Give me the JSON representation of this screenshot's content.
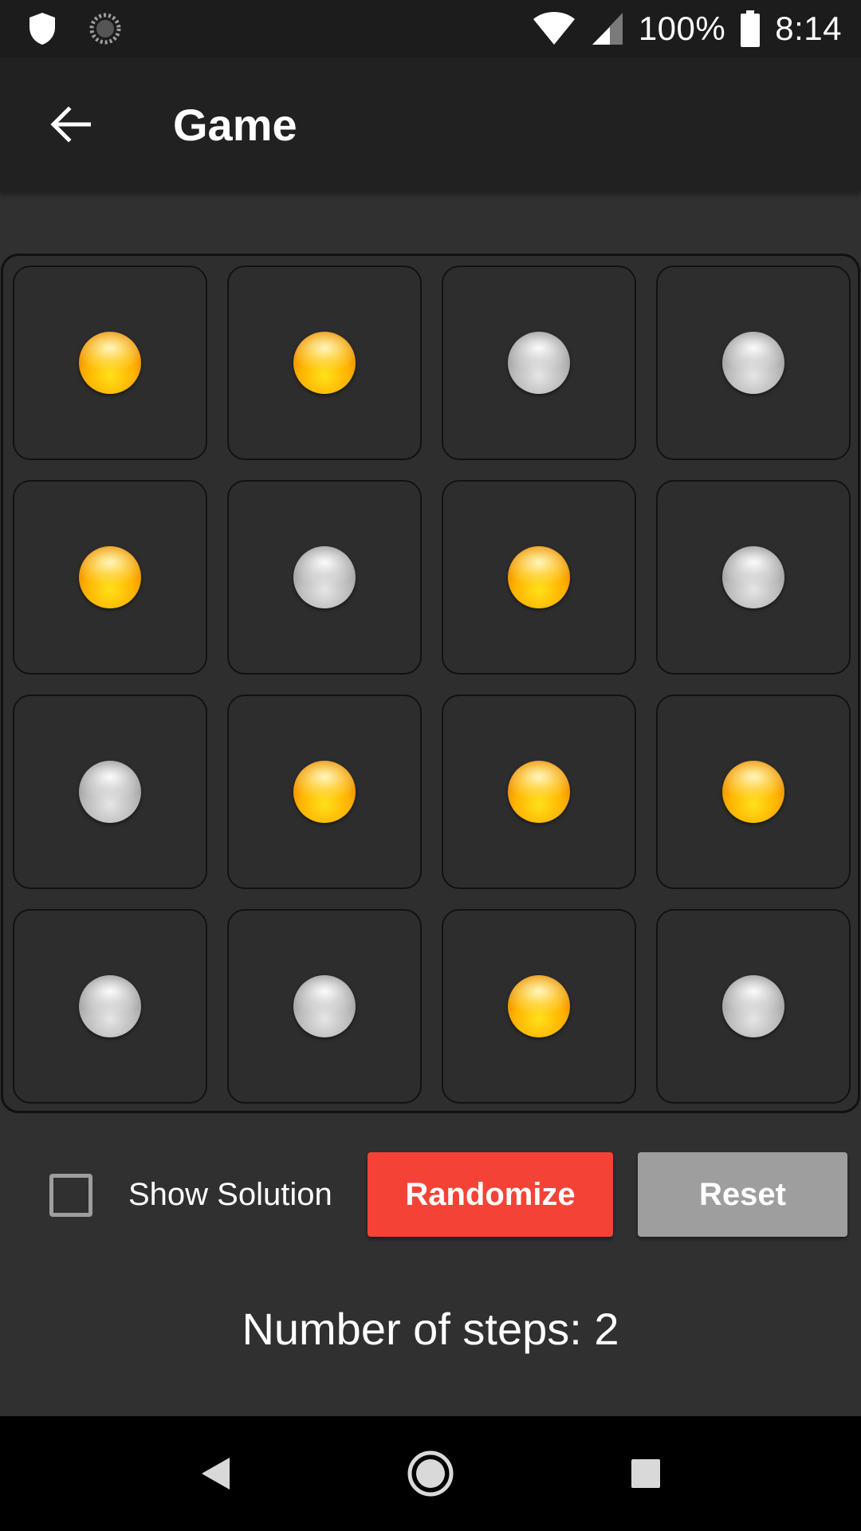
{
  "status_bar": {
    "battery_percent": "100%",
    "time": "8:14",
    "icons": [
      "shield-icon",
      "sync-icon",
      "wifi-icon",
      "cell-signal-icon",
      "battery-icon"
    ]
  },
  "app_bar": {
    "title": "Game",
    "back_icon": "arrow-back-icon"
  },
  "board": {
    "rows": 4,
    "cols": 4,
    "colors": {
      "on": "#ffb300",
      "off": "#bcbcbc"
    },
    "cells": [
      [
        "on",
        "on",
        "off",
        "off"
      ],
      [
        "on",
        "off",
        "on",
        "off"
      ],
      [
        "off",
        "on",
        "on",
        "on"
      ],
      [
        "off",
        "off",
        "on",
        "off"
      ]
    ]
  },
  "controls": {
    "show_solution_label": "Show Solution",
    "show_solution_checked": false,
    "randomize_label": "Randomize",
    "reset_label": "Reset",
    "randomize_color": "#f44336",
    "reset_color": "#9e9e9e"
  },
  "steps": {
    "label": "Number of steps:",
    "value": "2"
  },
  "nav_bar": {
    "icons": [
      "nav-back-icon",
      "nav-home-icon",
      "nav-recents-icon"
    ]
  }
}
